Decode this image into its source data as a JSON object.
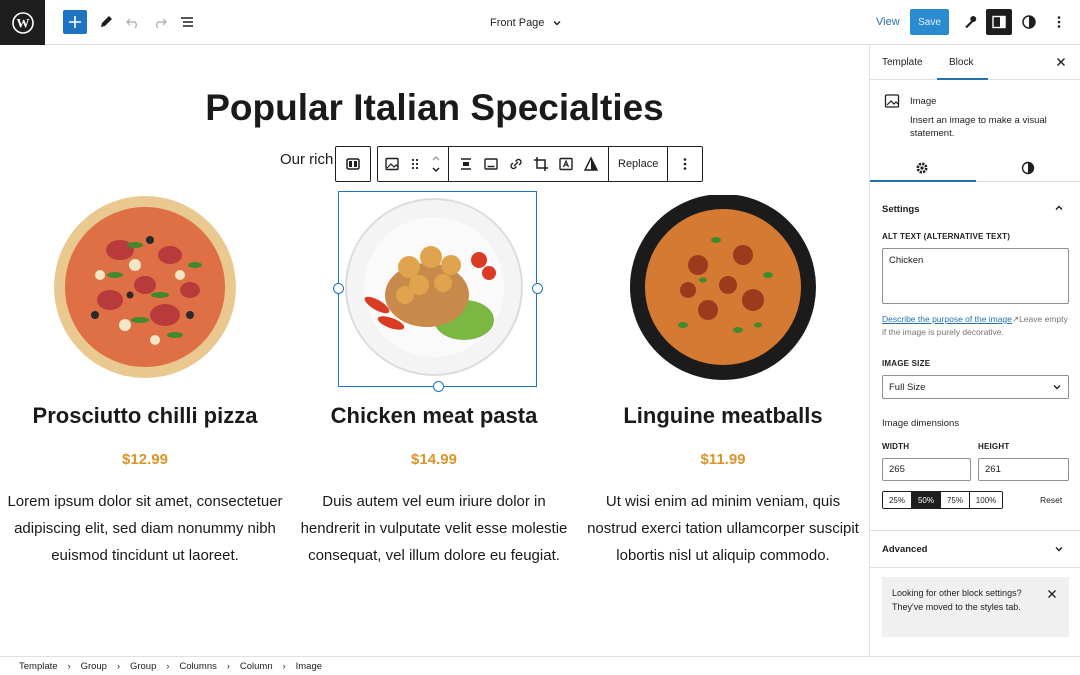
{
  "topbar": {
    "document_title": "Front Page",
    "view_label": "View",
    "save_label": "Save",
    "icons": [
      "wordpress-logo",
      "plus-icon",
      "pencil-icon",
      "undo-icon",
      "redo-icon",
      "list-view-icon",
      "chevron-down-icon",
      "wrench-icon",
      "sidebar-icon",
      "contrast-icon",
      "more-vertical-icon"
    ],
    "colors": {
      "primary": "#1e74c3",
      "save_bg": "#2a8bd0",
      "dark": "#1e1e1e"
    }
  },
  "canvas": {
    "heading": "Popular Italian Specialties",
    "intro": "Our rich",
    "toolbar": {
      "replace_label": "Replace"
    },
    "dishes": [
      {
        "name": "Prosciutto chilli pizza",
        "price": "$12.99",
        "description": "Lorem ipsum dolor sit amet, consectetuer adipiscing elit, sed diam nonummy nibh euismod tincidunt ut laoreet."
      },
      {
        "name": "Chicken meat pasta",
        "price": "$14.99",
        "description": "Duis autem vel eum iriure dolor in hendrerit in vulputate velit esse molestie consequat, vel illum dolore eu feugiat."
      },
      {
        "name": "Linguine meatballs",
        "price": "$11.99",
        "description": "Ut wisi enim ad minim veniam, quis nostrud exerci tation ullamcorper suscipit lobortis nisl ut aliquip commodo."
      }
    ],
    "price_color": "#d8952a"
  },
  "sidebar": {
    "tabs": [
      "Template",
      "Block"
    ],
    "active_tab": "Block",
    "block_name": "Image",
    "block_description": "Insert an image to make a visual statement.",
    "settings_title": "Settings",
    "alt_label": "ALT TEXT (ALTERNATIVE TEXT)",
    "alt_value": "Chicken",
    "help_link": "Describe the purpose of the image",
    "help_text_after": "Leave empty if the image is purely decorative.",
    "image_size_label": "IMAGE SIZE",
    "image_size_value": "Full Size",
    "dimensions_label": "Image dimensions",
    "width_label": "WIDTH",
    "width_value": "265",
    "height_label": "HEIGHT",
    "height_value": "261",
    "percent_options": [
      "25%",
      "50%",
      "75%",
      "100%"
    ],
    "percent_active": "50%",
    "reset_label": "Reset",
    "advanced_label": "Advanced",
    "notice": "Looking for other block settings? They've moved to the styles tab."
  },
  "breadcrumb": [
    "Template",
    "Group",
    "Group",
    "Columns",
    "Column",
    "Image"
  ]
}
